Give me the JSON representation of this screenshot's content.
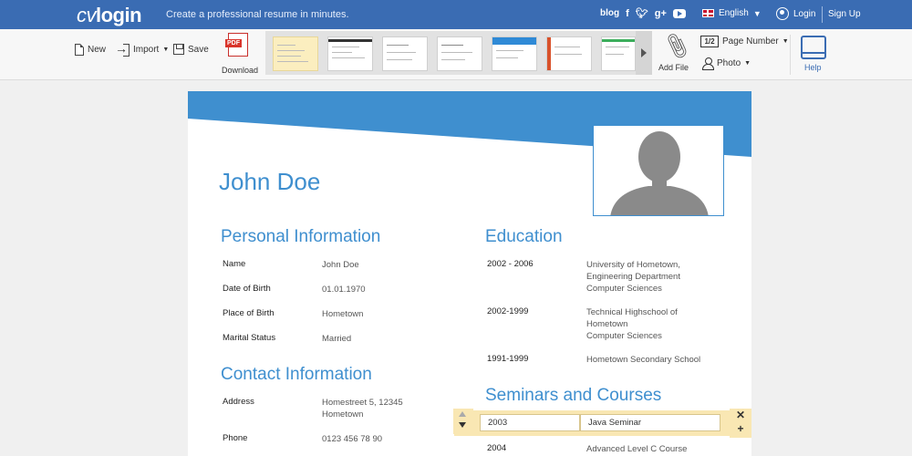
{
  "header": {
    "logo_cv": "cv",
    "logo_text": "login",
    "tagline": "Create a professional resume in minutes.",
    "blog": "blog",
    "language": "English",
    "login": "Login",
    "signup": "Sign Up"
  },
  "toolbar": {
    "new": "New",
    "import": "Import",
    "save": "Save",
    "pdf_badge": "PDF",
    "download": "Download",
    "add_file": "Add File",
    "page_number_icon": "1/2",
    "page_number": "Page Number",
    "photo": "Photo",
    "help": "Help"
  },
  "templates": [
    {
      "accent": "#f4d98a",
      "selected": true
    },
    {
      "accent": "#333333",
      "selected": false
    },
    {
      "accent": "#999999",
      "selected": false
    },
    {
      "accent": "#888888",
      "selected": false
    },
    {
      "accent": "#2f8ad6",
      "selected": false
    },
    {
      "accent": "#d9522b",
      "selected": false
    },
    {
      "accent": "#3cae5c",
      "selected": false
    }
  ],
  "colors": {
    "brand": "#3a6cb3",
    "resume_accent": "#3f8fcf",
    "edit_highlight": "#f9e7b3"
  },
  "resume": {
    "name": "John Doe",
    "personal_title": "Personal Information",
    "personal": [
      {
        "label": "Name",
        "value": "John Doe"
      },
      {
        "label": "Date of Birth",
        "value": "01.01.1970"
      },
      {
        "label": "Place of Birth",
        "value": "Hometown"
      },
      {
        "label": "Marital Status",
        "value": "Married"
      }
    ],
    "contact_title": "Contact Information",
    "contact": [
      {
        "label": "Address",
        "value": "Homestreet 5, 12345\nHometown"
      },
      {
        "label": "Phone",
        "value": "0123 456 78 90"
      }
    ],
    "education_title": "Education",
    "education": [
      {
        "years": "2002 - 2006",
        "value": "University of Hometown,\nEngineering Department\nComputer Sciences"
      },
      {
        "years": "2002-1999",
        "value": "Technical Highschool of\nHometown\nComputer Sciences"
      },
      {
        "years": "1991-1999",
        "value": "Hometown Secondary School"
      }
    ],
    "seminars_title": "Seminars and Courses",
    "seminars": [
      {
        "year": "2003",
        "value": "Java Seminar"
      },
      {
        "year": "2004",
        "value": "Advanced Level C Course"
      }
    ]
  }
}
